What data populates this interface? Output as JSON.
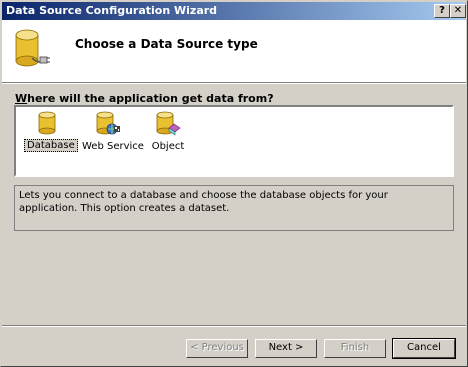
{
  "window": {
    "title": "Data Source Configuration Wizard",
    "help_label": "?",
    "close_label": "✕"
  },
  "header": {
    "title": "Choose a Data Source type"
  },
  "question": {
    "prefix": "W",
    "rest": "here will the application get data from?"
  },
  "sources": [
    {
      "label": "Database",
      "icon": "database-icon",
      "selected": true
    },
    {
      "label": "Web Service",
      "icon": "web-service-icon",
      "selected": false
    },
    {
      "label": "Object",
      "icon": "object-icon",
      "selected": false
    }
  ],
  "description": "Lets you connect to a database and choose the database objects for your application. This option creates a dataset.",
  "buttons": {
    "previous": "< Previous",
    "next": "Next >",
    "finish": "Finish",
    "cancel": "Cancel"
  },
  "colors": {
    "titlebar_start": "#0a246a",
    "titlebar_end": "#a6caf0",
    "dialog_bg": "#d4d0c8",
    "cylinder": "#e8c030"
  }
}
